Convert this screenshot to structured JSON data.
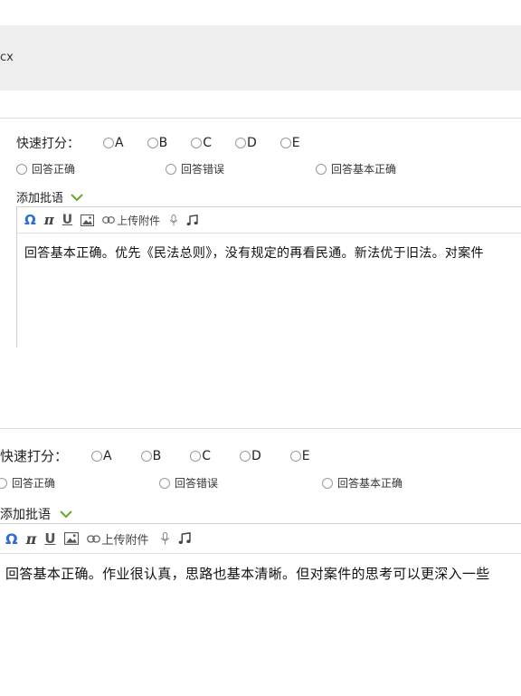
{
  "file": {
    "name": "cx"
  },
  "grading": [
    {
      "quick_score_label": "快速打分：",
      "grades": [
        "A",
        "B",
        "C",
        "D",
        "E"
      ],
      "quick_replies": [
        "回答正确",
        "回答错误",
        "回答基本正确"
      ],
      "add_comment_label": "添加批语",
      "toolbar": {
        "upload_label": "上传附件"
      },
      "comment_text": "回答基本正确。优先《民法总则》，没有规定的再看民通。新法优于旧法。对案件"
    },
    {
      "quick_score_label": "快速打分：",
      "grades": [
        "A",
        "B",
        "C",
        "D",
        "E"
      ],
      "quick_replies": [
        "回答正确",
        "回答错误",
        "回答基本正确"
      ],
      "add_comment_label": "添加批语",
      "toolbar": {
        "upload_label": "上传附件"
      },
      "comment_text": "回答基本正确。作业很认真，思路也基本清晰。但对案件的思考可以更深入一些"
    }
  ],
  "colors": {
    "accent_blue": "#2c6fd1",
    "chevron_green": "#6aa82a"
  },
  "icons": [
    "omega-icon",
    "pi-icon",
    "underline-icon",
    "image-icon",
    "link-icon",
    "microphone-icon",
    "music-note-icon",
    "chevron-down-icon"
  ]
}
